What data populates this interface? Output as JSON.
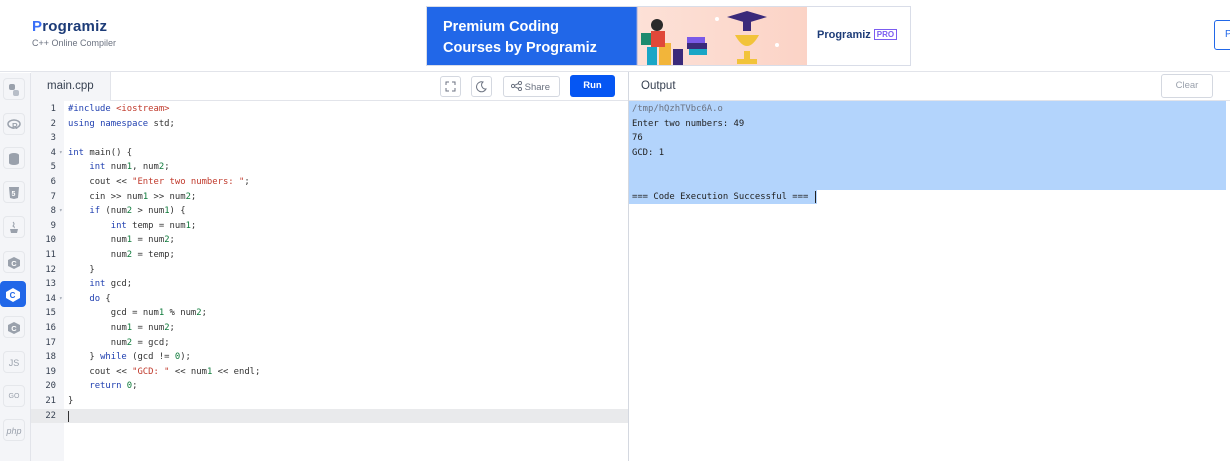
{
  "header": {
    "logo_name": "rogramiz",
    "logo_prefix": "P",
    "logo_subtitle": "C++ Online Compiler",
    "ad": {
      "line1": "Premium Coding",
      "line2": "Courses by Programiz",
      "brand": "Programiz",
      "badge": "PRO"
    },
    "right_button": "P"
  },
  "sidenav": {
    "items": [
      {
        "icon": "python-icon",
        "label": "Py"
      },
      {
        "icon": "r-icon",
        "label": "R"
      },
      {
        "icon": "sql-icon",
        "label": "SQL"
      },
      {
        "icon": "html-icon",
        "label": "5"
      },
      {
        "icon": "java-icon",
        "label": "J"
      },
      {
        "icon": "c-icon",
        "label": "C"
      },
      {
        "icon": "cpp-icon",
        "label": "C++",
        "active": true
      },
      {
        "icon": "csharp-icon",
        "label": "C#"
      },
      {
        "icon": "js-icon",
        "label": "JS"
      },
      {
        "icon": "go-icon",
        "label": "GO"
      },
      {
        "icon": "php-icon",
        "label": "php"
      }
    ]
  },
  "editor": {
    "filename": "main.cpp",
    "share_label": "Share",
    "run_label": "Run",
    "lines": [
      "#include <iostream>",
      "using namespace std;",
      "",
      "int main() {",
      "    int num1, num2;",
      "    cout << \"Enter two numbers: \";",
      "    cin >> num1 >> num2;",
      "    if (num2 > num1) {",
      "        int temp = num1;",
      "        num1 = num2;",
      "        num2 = temp;",
      "    }",
      "    int gcd;",
      "    do {",
      "        gcd = num1 % num2;",
      "        num1 = num2;",
      "        num2 = gcd;",
      "    } while (gcd != 0);",
      "    cout << \"GCD: \" << num1 << endl;",
      "    return 0;",
      "}",
      ""
    ],
    "folded_lines": [
      4,
      8,
      14
    ]
  },
  "output": {
    "title": "Output",
    "clear_label": "Clear",
    "path": "/tmp/hQzhTVbc6A.o",
    "line1": "Enter two numbers: 49",
    "line2": "76",
    "line3": "GCD: 1",
    "status": "=== Code Execution Successful ==="
  },
  "colors": {
    "accent": "#0556f3",
    "selection": "#b3d4fc"
  }
}
